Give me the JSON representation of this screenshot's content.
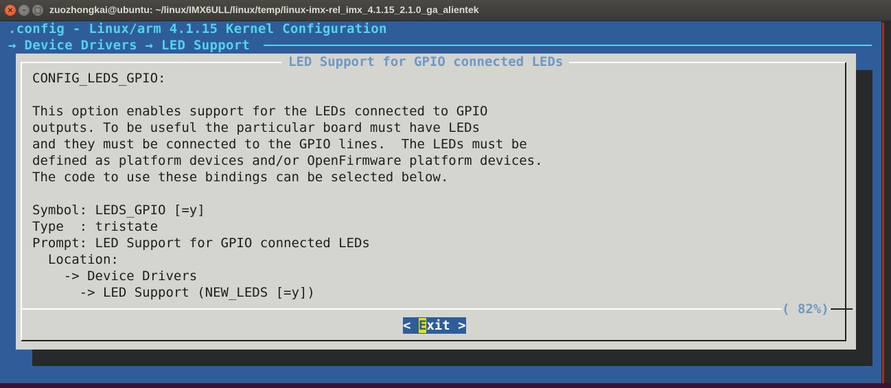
{
  "window": {
    "title": "zuozhongkai@ubuntu: ~/linux/IMX6ULL/linux/temp/linux-imx-rel_imx_4.1.15_2.1.0_ga_alientek",
    "close_glyph": "×",
    "minimize_glyph": "–",
    "maximize_glyph": "□"
  },
  "menuconfig": {
    "header": ".config - Linux/arm 4.1.15 Kernel Configuration",
    "breadcrumb": "→ Device Drivers → LED Support"
  },
  "dialog": {
    "title": "LED Support for GPIO connected LEDs",
    "lines": [
      "CONFIG_LEDS_GPIO:",
      "",
      "This option enables support for the LEDs connected to GPIO",
      "outputs. To be useful the particular board must have LEDs",
      "and they must be connected to the GPIO lines.  The LEDs must be",
      "defined as platform devices and/or OpenFirmware platform devices.",
      "The code to use these bindings can be selected below.",
      "",
      "Symbol: LEDS_GPIO [=y]",
      "Type  : tristate",
      "Prompt: LED Support for GPIO connected LEDs",
      "  Location:",
      "    -> Device Drivers",
      "      -> LED Support (NEW_LEDS [=y])"
    ],
    "scroll_percent": "( 82%)",
    "exit_button": {
      "prefix": "< ",
      "hotkey": "E",
      "rest": "xit >"
    }
  },
  "colors": {
    "terminal_bg": "#2f5d9a",
    "dialog_bg": "#d5d5cf",
    "header_text": "#52d3ec",
    "dialog_title_text": "#6c98c8",
    "hotkey_bg": "#e4e400"
  }
}
